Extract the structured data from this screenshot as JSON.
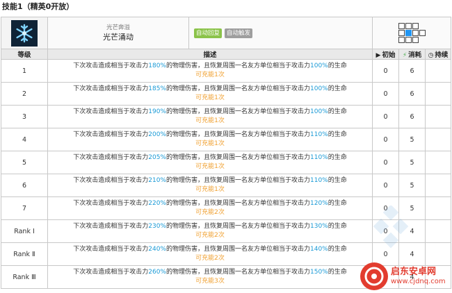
{
  "page": {
    "title": "技能1（精英0开放）"
  },
  "skill": {
    "subtitle": "光芒奔溢",
    "name": "光芒涌动",
    "tags": [
      {
        "label": "自动回复",
        "color": "#8bc34a"
      },
      {
        "label": "自动触发",
        "color": "#9e9e9e"
      }
    ],
    "icon": "skill-snowflake-icon"
  },
  "columns": {
    "level": "等级",
    "description": "描述",
    "initial": "初始",
    "cost": "消耗",
    "duration": "持续"
  },
  "desc_template": {
    "part1": "下次攻击造成相当于攻击力",
    "part2": "的物理伤害，且恢复周围一名友方单位相当于攻击力",
    "part3": "的生命"
  },
  "rows": [
    {
      "level": "1",
      "atk": "180%",
      "heal": "100%",
      "charges": "可充能1次",
      "initial": "0",
      "cost": "6",
      "duration": ""
    },
    {
      "level": "2",
      "atk": "185%",
      "heal": "100%",
      "charges": "可充能1次",
      "initial": "0",
      "cost": "6",
      "duration": ""
    },
    {
      "level": "3",
      "atk": "190%",
      "heal": "100%",
      "charges": "可充能1次",
      "initial": "0",
      "cost": "6",
      "duration": ""
    },
    {
      "level": "4",
      "atk": "200%",
      "heal": "110%",
      "charges": "可充能1次",
      "initial": "0",
      "cost": "5",
      "duration": ""
    },
    {
      "level": "5",
      "atk": "205%",
      "heal": "110%",
      "charges": "可充能1次",
      "initial": "0",
      "cost": "5",
      "duration": ""
    },
    {
      "level": "6",
      "atk": "210%",
      "heal": "110%",
      "charges": "可充能1次",
      "initial": "0",
      "cost": "5",
      "duration": ""
    },
    {
      "level": "7",
      "atk": "220%",
      "heal": "120%",
      "charges": "可充能2次",
      "initial": "0",
      "cost": "5",
      "duration": ""
    },
    {
      "level": "Rank Ⅰ",
      "atk": "230%",
      "heal": "130%",
      "charges": "可充能2次",
      "initial": "0",
      "cost": "4",
      "duration": ""
    },
    {
      "level": "Rank Ⅱ",
      "atk": "240%",
      "heal": "140%",
      "charges": "可充能2次",
      "initial": "0",
      "cost": "4",
      "duration": ""
    },
    {
      "level": "Rank Ⅲ",
      "atk": "260%",
      "heal": "150%",
      "charges": "可充能3次",
      "initial": "0",
      "cost": "4",
      "duration": ""
    }
  ],
  "watermark": {
    "title": "启东安卓网",
    "url": "www.cjdnq.com"
  },
  "colors": {
    "highlight": "#1a9ad6",
    "charge": "#f0a030",
    "tag_green": "#8bc34a",
    "tag_gray": "#9e9e9e"
  }
}
